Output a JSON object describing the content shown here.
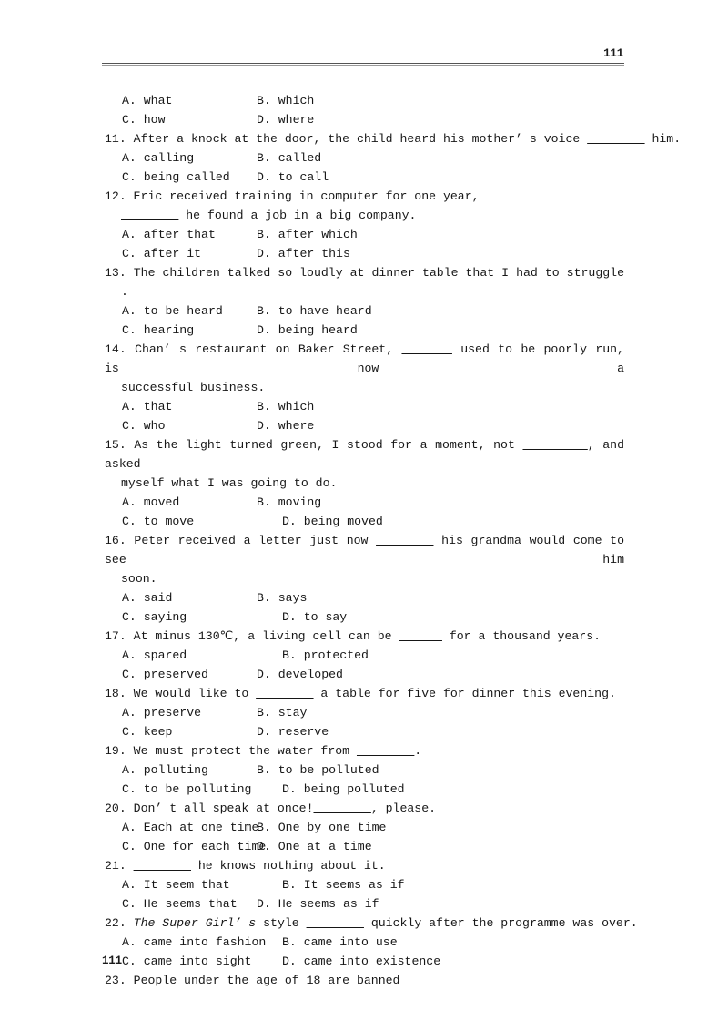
{
  "header": {
    "page_number": "111"
  },
  "footer": {
    "page_number": "111"
  },
  "exercise": {
    "orphan_options": {
      "a": "A. what",
      "b": "B. which",
      "c": "C. how",
      "d": "D. where"
    },
    "questions": [
      {
        "number": "11.",
        "stem": "11. After a knock at the door, the child heard his mother’ s voice",
        "stem_blank": "________",
        "stem_tail": " him.",
        "options": {
          "a": "A. calling",
          "b": "B. called",
          "c": "C. being called",
          "d": "D. to call"
        }
      },
      {
        "number": "12.",
        "stem": "12. Eric received training in computer for one year,",
        "stem_line2_blank": "________",
        "stem_line2_tail": " he found a job in a big company.",
        "options": {
          "a": "A. after that",
          "b": "B. after which",
          "c": "C. after it",
          "d": "D. after this"
        }
      },
      {
        "number": "13.",
        "stem": "13.  The children talked so loudly at dinner table that I had to struggle",
        "stem_line2": ".",
        "options": {
          "a": "A. to be heard",
          "b": "B. to have heard",
          "c": "C. hearing",
          "d": "D. being heard"
        }
      },
      {
        "number": "14.",
        "stem_head": "14. Chan’ s restaurant on Baker Street, ",
        "stem_blank": "_______",
        "stem_tail": " used to be poorly run, is now a",
        "stem_line2": "successful business.",
        "options": {
          "a": "A. that",
          "b": "B. which",
          "c": "C. who",
          "d": "D. where"
        }
      },
      {
        "number": "15.",
        "stem_head": "15. As the light turned green, I stood for a moment, not ",
        "stem_blank": "_________",
        "stem_tail": ", and asked",
        "stem_line2": "myself what I was going to do.",
        "options": {
          "a": "A. moved",
          "b": "B. moving",
          "c": "C. to move",
          "d": "D. being moved"
        }
      },
      {
        "number": "16.",
        "stem_head": "16. Peter received a letter just now ",
        "stem_blank": "________",
        "stem_tail": " his grandma would come to see him",
        "stem_line2": "soon.",
        "options": {
          "a": "A. said",
          "b": "B. says",
          "c": "C. saying",
          "d": "D. to say"
        }
      },
      {
        "number": "17.",
        "stem_head": "17. At minus 130℃, a living cell can be ",
        "stem_blank": "______",
        "stem_tail": " for a thousand years.",
        "options": {
          "a": "A. spared",
          "b": "B. protected",
          "c": "C. preserved",
          "d": "D. developed"
        }
      },
      {
        "number": "18.",
        "stem_head": "18. We would like to ",
        "stem_blank": "________",
        "stem_tail": " a table for five for dinner this evening.",
        "options": {
          "a": "A. preserve",
          "b": "B. stay",
          "c": "C. keep",
          "d": "D. reserve"
        }
      },
      {
        "number": "19.",
        "stem_head": "19. We must protect the water from ",
        "stem_blank": "________",
        "stem_tail": ".",
        "options": {
          "a": "A. polluting",
          "b": "B. to be polluted",
          "c": "C. to be polluting",
          "d": "D. being polluted"
        }
      },
      {
        "number": "20.",
        "stem_head": "20. Don’ t all speak at once!",
        "stem_blank": "________",
        "stem_tail": ", please.",
        "options": {
          "a": "A. Each at one time",
          "b": "B. One by one time",
          "c": "C. One for each time",
          "d": "D. One at a time"
        }
      },
      {
        "number": "21.",
        "stem_head": "21. ",
        "stem_blank": "________",
        "stem_tail": " he knows nothing about it.",
        "options": {
          "a": "A. It seem that",
          "b": "B. It seems as if",
          "c": "C. He seems that",
          "d": "D. He seems as if"
        }
      },
      {
        "number": "22.",
        "stem_prefix": "22. ",
        "stem_italic": "The Super Girl’ s",
        "stem_mid": " style ",
        "stem_blank": "________",
        "stem_tail": " quickly after the programme was over.",
        "options": {
          "a": "A. came into fashion",
          "b": "B. came into use",
          "c": "C. came into sight",
          "d": "D. came into existence"
        }
      },
      {
        "number": "23.",
        "stem_head": "23. People under the age of 18 are banned",
        "stem_blank": "________"
      }
    ]
  }
}
